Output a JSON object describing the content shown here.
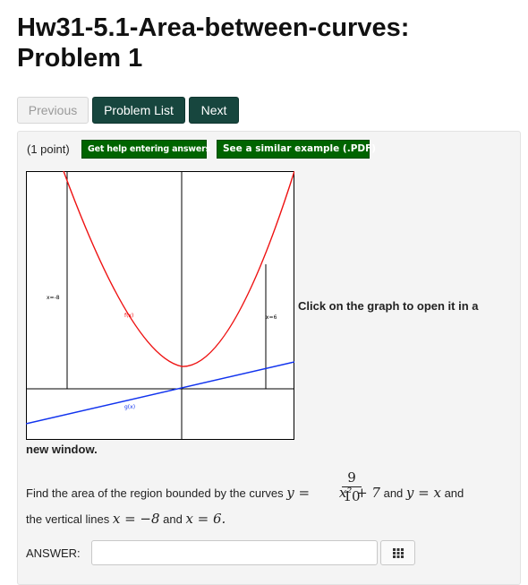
{
  "page": {
    "title": "Hw31-5.1-Area-between-curves: Problem 1"
  },
  "nav": {
    "previous": "Previous",
    "problem_list": "Problem List",
    "next": "Next"
  },
  "problem": {
    "points": "(1 point)",
    "help_button": "Get help entering answers",
    "example_button": "See a similar example (.PDF)",
    "graph": {
      "label_left": "x=-8",
      "label_right": "x=6",
      "label_f": "f(x)",
      "label_g": "g(x)",
      "f_color": "#ee1111",
      "g_color": "#1133ee"
    },
    "click_text_1": "Click on the graph to open it in a",
    "click_text_2": "new window.",
    "text_intro": "Find the area of the region bounded by the curves",
    "eq1_lhs": "y",
    "eq1_eq": " = ",
    "frac_num": "9",
    "frac_den": "10",
    "eq1_rest": "x² + 7",
    "and1": " and ",
    "eq2": "y = x",
    "and2": " and",
    "text_lines": "the vertical lines",
    "line1": "x = −8",
    "and3": " and ",
    "line2": "x = 6.",
    "answer_label": "ANSWER:"
  },
  "icons": {
    "equation_editor": "grid-icon"
  }
}
